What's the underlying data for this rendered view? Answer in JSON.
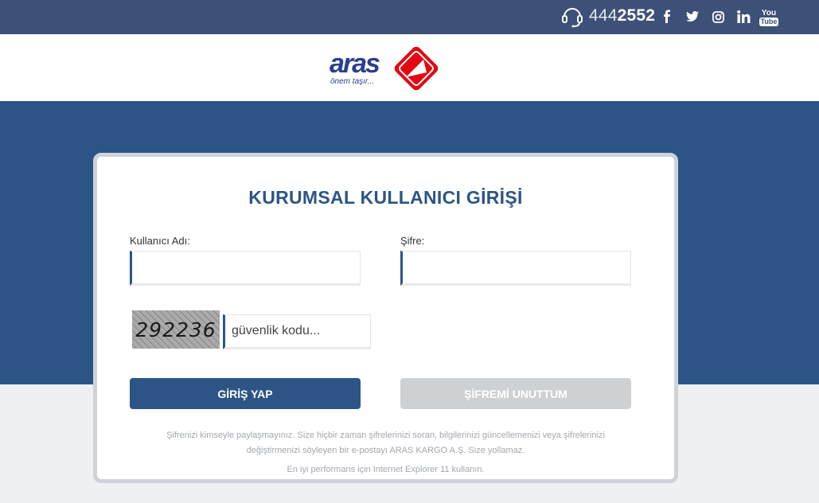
{
  "topbar": {
    "phone_prefix": "444",
    "phone_suffix": "2552",
    "social": [
      "facebook-icon",
      "twitter-icon",
      "instagram-icon",
      "linkedin-icon",
      "youtube-icon"
    ],
    "youtube_you": "You",
    "youtube_tube": "Tube"
  },
  "logo": {
    "word": "aras",
    "tagline": "önem taşır..."
  },
  "login": {
    "title": "KURUMSAL KULLANICI GİRİŞİ",
    "username_label": "Kullanıcı Adı:",
    "username_value": "",
    "password_label": "Şifre:",
    "password_value": "",
    "captcha_code": "292236",
    "captcha_placeholder": "güvenlik kodu...",
    "login_button": "GİRİŞ YAP",
    "forgot_button": "ŞİFREMİ UNUTTUM",
    "notice_line1": "Şifrenizi kimseyle paylaşmayınız. Size hiçbir zaman şifrelerinizi soran, bilgilerinizi güncellemenizi veya şifrelerinizi",
    "notice_line2": "değiştirmenizi söyleyen bir e-postayı ARAS KARGO A.Ş. Size yollamaz.",
    "notice_line3": "En iyi performans için Internet Explorer 11 kullanın."
  },
  "colors": {
    "topbar": "#3d5178",
    "brand_blue": "#2c5586",
    "logo_red": "#e30613",
    "disabled_button": "#cfd0d2"
  }
}
